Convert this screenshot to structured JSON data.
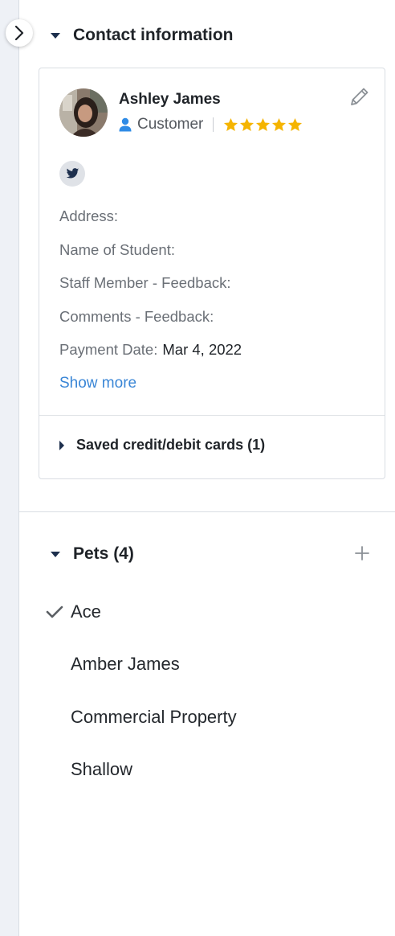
{
  "contact_section": {
    "title": "Contact information",
    "customer": {
      "name": "Ashley James",
      "role": "Customer",
      "rating": 5
    },
    "fields": [
      {
        "label": "Address:",
        "value": ""
      },
      {
        "label": "Name of Student:",
        "value": ""
      },
      {
        "label": "Staff Member - Feedback:",
        "value": ""
      },
      {
        "label": "Comments - Feedback:",
        "value": ""
      },
      {
        "label": "Payment Date:",
        "value": "Mar 4, 2022"
      }
    ],
    "show_more": "Show more",
    "saved_cards": "Saved credit/debit cards (1)"
  },
  "pets_section": {
    "title": "Pets (4)",
    "items": [
      {
        "label": "Ace",
        "selected": true
      },
      {
        "label": "Amber James",
        "selected": false
      },
      {
        "label": "Commercial Property",
        "selected": false
      },
      {
        "label": "Shallow",
        "selected": false
      }
    ]
  },
  "icons": {
    "collapse": "chevron-right-icon",
    "edit": "pencil-icon",
    "role": "user-icon",
    "social": "twitter-icon",
    "add": "plus-icon",
    "check": "check-icon"
  },
  "colors": {
    "accent_link": "#3a86d6",
    "star": "#f5b400",
    "role_icon": "#2f8be6",
    "sidebar_strip": "#eef1f6"
  }
}
